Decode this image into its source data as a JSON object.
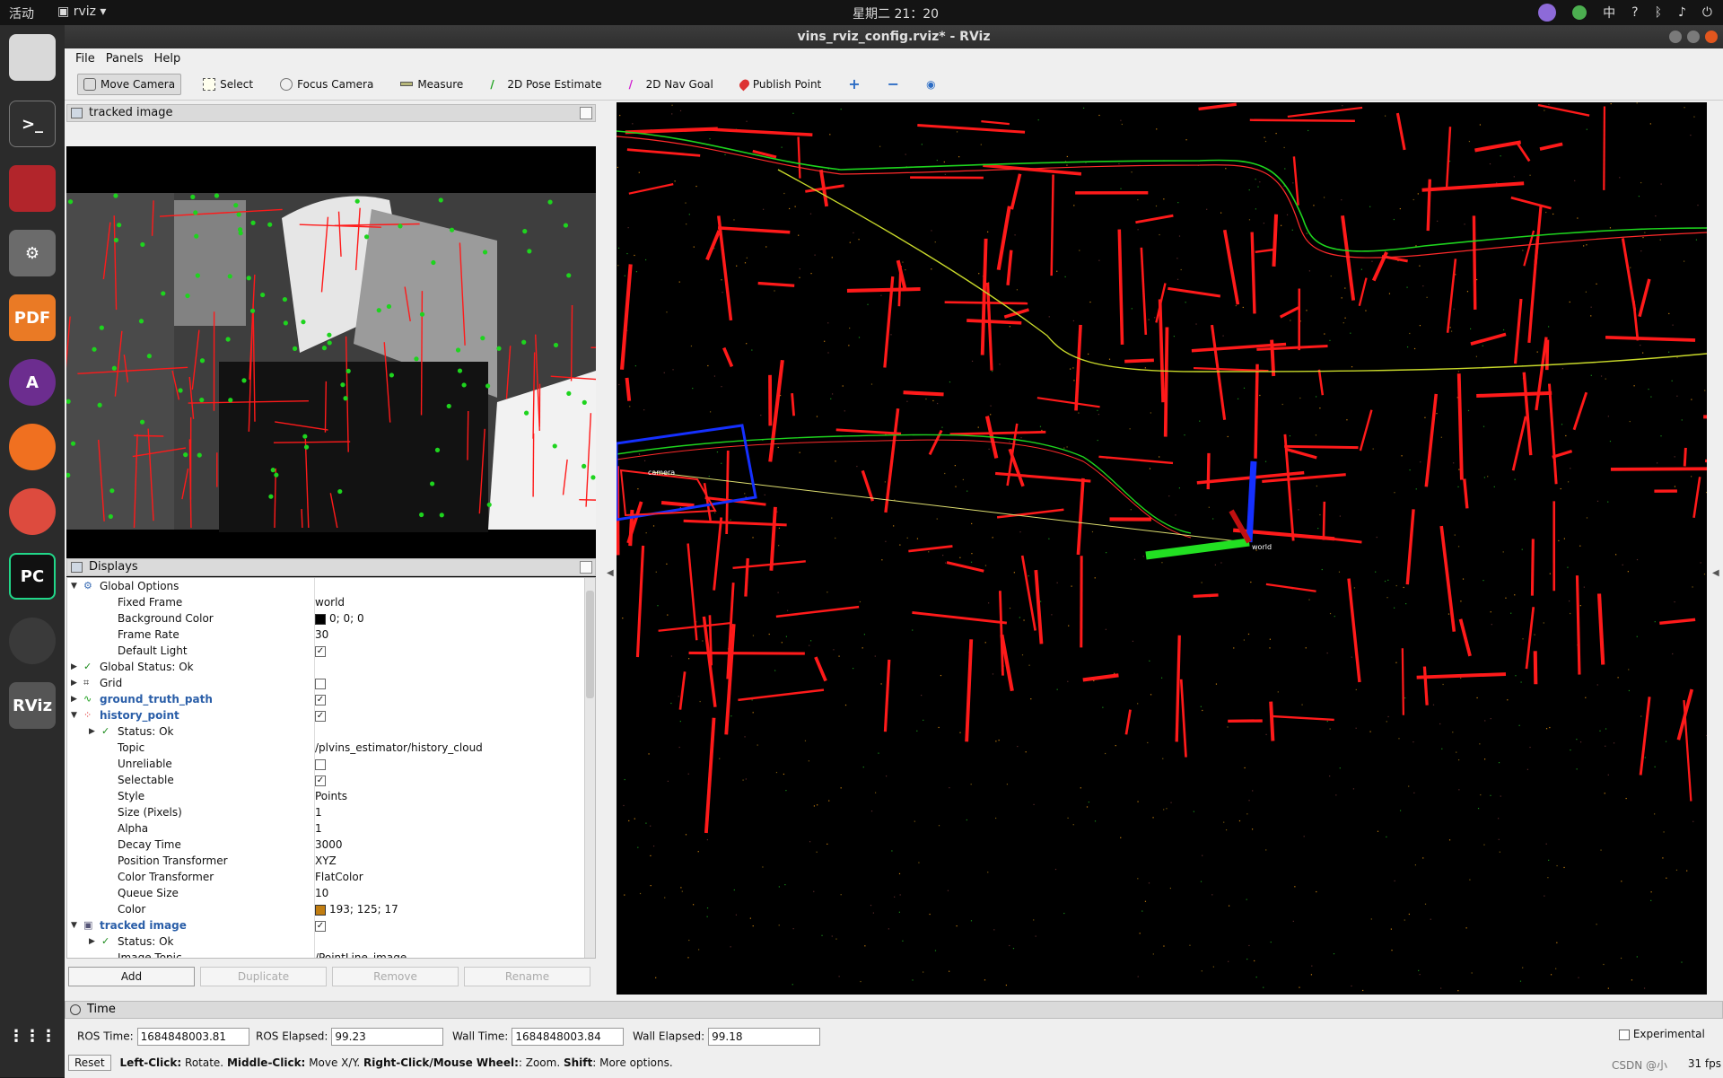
{
  "topbar": {
    "activities": "活动",
    "app": "rviz",
    "clock": "星期二 21：20",
    "ime": "中"
  },
  "window": {
    "title": "vins_rviz_config.rviz* - RViz"
  },
  "menu": [
    "File",
    "Panels",
    "Help"
  ],
  "toolbar": [
    {
      "label": "Move Camera",
      "icon": "move-camera-icon",
      "active": true
    },
    {
      "label": "Select",
      "icon": "select-icon"
    },
    {
      "label": "Focus Camera",
      "icon": "focus-camera-icon"
    },
    {
      "label": "Measure",
      "icon": "measure-icon"
    },
    {
      "label": "2D Pose Estimate",
      "icon": "pose-estimate-icon"
    },
    {
      "label": "2D Nav Goal",
      "icon": "nav-goal-icon"
    },
    {
      "label": "Publish Point",
      "icon": "publish-point-icon"
    }
  ],
  "panels": {
    "image_title": "tracked image",
    "displays_title": "Displays",
    "time_title": "Time"
  },
  "displays": [
    {
      "indent": 0,
      "arrow": "down",
      "icon": "gear",
      "name": "Global Options",
      "value": ""
    },
    {
      "indent": 1,
      "name": "Fixed Frame",
      "value": "world"
    },
    {
      "indent": 1,
      "name": "Background Color",
      "value": "0; 0; 0",
      "swatch": "#000000"
    },
    {
      "indent": 1,
      "name": "Frame Rate",
      "value": "30"
    },
    {
      "indent": 1,
      "name": "Default Light",
      "check": true
    },
    {
      "indent": 0,
      "arrow": "right",
      "icon": "check",
      "name": "Global Status: Ok",
      "value": ""
    },
    {
      "indent": 0,
      "arrow": "right",
      "icon": "grid",
      "name": "Grid",
      "check": false
    },
    {
      "indent": 0,
      "arrow": "right",
      "icon": "path",
      "name": "ground_truth_path",
      "check": true,
      "bold": true
    },
    {
      "indent": 0,
      "arrow": "down",
      "icon": "points",
      "name": "history_point",
      "check": true,
      "bold": true
    },
    {
      "indent": 1,
      "arrow": "right",
      "icon": "check",
      "name": "Status: Ok",
      "value": ""
    },
    {
      "indent": 1,
      "name": "Topic",
      "value": "/plvins_estimator/history_cloud"
    },
    {
      "indent": 1,
      "name": "Unreliable",
      "check": false
    },
    {
      "indent": 1,
      "name": "Selectable",
      "check": true
    },
    {
      "indent": 1,
      "name": "Style",
      "value": "Points"
    },
    {
      "indent": 1,
      "name": "Size (Pixels)",
      "value": "1"
    },
    {
      "indent": 1,
      "name": "Alpha",
      "value": "1"
    },
    {
      "indent": 1,
      "name": "Decay Time",
      "value": "3000"
    },
    {
      "indent": 1,
      "name": "Position Transformer",
      "value": "XYZ"
    },
    {
      "indent": 1,
      "name": "Color Transformer",
      "value": "FlatColor"
    },
    {
      "indent": 1,
      "name": "Queue Size",
      "value": "10"
    },
    {
      "indent": 1,
      "name": "Color",
      "value": "193; 125; 17",
      "swatch": "#c17d11"
    },
    {
      "indent": 0,
      "arrow": "down",
      "icon": "image",
      "name": "tracked image",
      "check": true,
      "bold": true
    },
    {
      "indent": 1,
      "arrow": "right",
      "icon": "check",
      "name": "Status: Ok",
      "value": ""
    },
    {
      "indent": 1,
      "name": "Image Topic",
      "value": "/PointLine_image"
    }
  ],
  "display_buttons": {
    "add": "Add",
    "duplicate": "Duplicate",
    "remove": "Remove",
    "rename": "Rename"
  },
  "time": {
    "ros_time_label": "ROS Time:",
    "ros_time": "1684848003.81",
    "ros_elapsed_label": "ROS Elapsed:",
    "ros_elapsed": "99.23",
    "wall_time_label": "Wall Time:",
    "wall_time": "1684848003.84",
    "wall_elapsed_label": "Wall Elapsed:",
    "wall_elapsed": "99.18",
    "experimental": "Experimental"
  },
  "status": {
    "reset": "Reset",
    "lc": "Left-Click:",
    "lc_t": "Rotate.",
    "mc": "Middle-Click:",
    "mc_t": "Move X/Y.",
    "rc": "Right-Click/Mouse Wheel:",
    "rc_t": ": Zoom.",
    "sh": "Shift",
    "sh_t": ": More options."
  },
  "fps": "31 fps",
  "watermark": "CSDN @小",
  "viewport_labels": {
    "camera": "camera",
    "world": "world"
  },
  "colors": {
    "accent": "#2a5ea8",
    "line": "#ff1a1a",
    "feature": "#1ed41e"
  }
}
